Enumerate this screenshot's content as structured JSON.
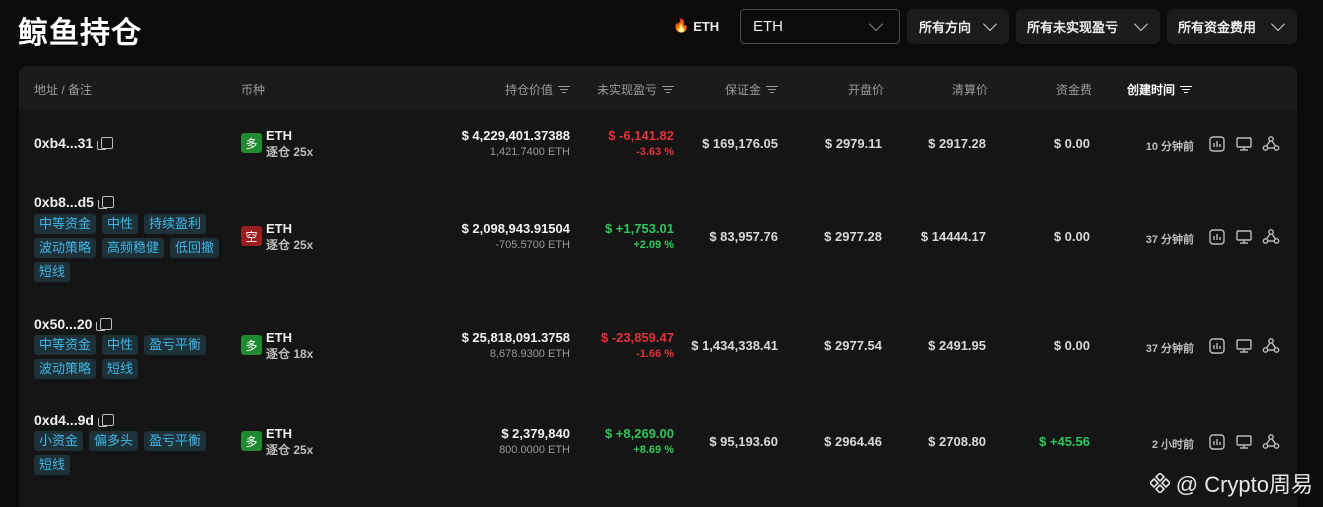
{
  "header": {
    "title": "鲸鱼持仓",
    "token_badge": "ETH",
    "coin_select": "ETH",
    "direction_select": "所有方向",
    "pnl_select": "所有未实现盈亏",
    "funding_select": "所有资金费用"
  },
  "columns": {
    "address": "地址 / 备注",
    "coin": "币种",
    "value": "持仓价值",
    "pnl": "未实现盈亏",
    "margin": "保证金",
    "open": "开盘价",
    "liq": "清算价",
    "funding": "资金费",
    "created": "创建时间"
  },
  "rows": [
    {
      "address": "0xb4...31",
      "tags": [],
      "side": "多",
      "side_type": "long",
      "coin": "ETH",
      "leverage": "逐仓 25x",
      "value": "$ 4,229,401.37388",
      "size": "1,421.7400 ETH",
      "pnl": "$ -6,141.82",
      "pnl_pct": "-3.63 %",
      "pnl_sign": "neg",
      "margin": "$ 169,176.05",
      "open": "$ 2979.11",
      "liq": "$ 2917.28",
      "funding": "$ 0.00",
      "time": "10 分钟前"
    },
    {
      "address": "0xb8...d5",
      "tags": [
        "中等资金",
        "中性",
        "持续盈利",
        "波动策略",
        "高频稳健",
        "低回撤",
        "短线"
      ],
      "side": "空",
      "side_type": "short",
      "coin": "ETH",
      "leverage": "逐仓 25x",
      "value": "$ 2,098,943.91504",
      "size": "-705.5700 ETH",
      "pnl": "$ +1,753.01",
      "pnl_pct": "+2.09 %",
      "pnl_sign": "pos",
      "margin": "$ 83,957.76",
      "open": "$ 2977.28",
      "liq": "$ 14444.17",
      "funding": "$ 0.00",
      "time": "37 分钟前"
    },
    {
      "address": "0x50...20",
      "tags": [
        "中等资金",
        "中性",
        "盈亏平衡",
        "波动策略",
        "短线"
      ],
      "side": "多",
      "side_type": "long",
      "coin": "ETH",
      "leverage": "逐仓 18x",
      "value": "$ 25,818,091.3758",
      "size": "8,678.9300 ETH",
      "pnl": "$ -23,859.47",
      "pnl_pct": "-1.66 %",
      "pnl_sign": "neg",
      "margin": "$ 1,434,338.41",
      "open": "$ 2977.54",
      "liq": "$ 2491.95",
      "funding": "$ 0.00",
      "time": "37 分钟前"
    },
    {
      "address": "0xd4...9d",
      "tags": [
        "小资金",
        "偏多头",
        "盈亏平衡",
        "短线"
      ],
      "side": "多",
      "side_type": "long",
      "coin": "ETH",
      "leverage": "逐仓 25x",
      "value": "$ 2,379,840",
      "size": "800.0000 ETH",
      "pnl": "$ +8,269.00",
      "pnl_pct": "+8.69 %",
      "pnl_sign": "pos",
      "margin": "$ 95,193.60",
      "open": "$ 2964.46",
      "liq": "$ 2708.80",
      "funding": "$ +45.56",
      "funding_positive": true,
      "time": "2 小时前"
    }
  ],
  "watermark": "@ Crypto周易"
}
